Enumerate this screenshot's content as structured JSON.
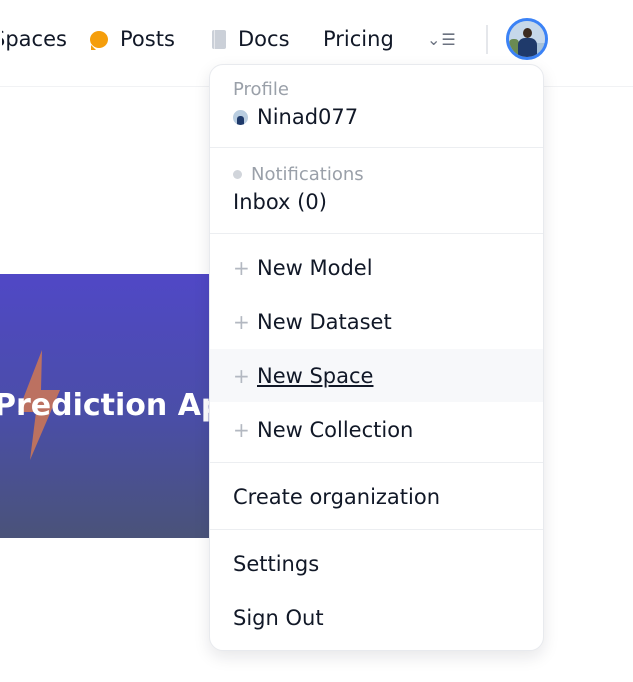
{
  "nav": {
    "spaces_label": "Spaces",
    "posts_label": "Posts",
    "docs_label": "Docs",
    "pricing_label": "Pricing",
    "more_icon": "chevron-menu-icon"
  },
  "banner": {
    "title": "Prediction App"
  },
  "menu": {
    "profile": {
      "section_label": "Profile",
      "username": "Ninad077"
    },
    "notifications": {
      "section_label": "Notifications",
      "inbox_label": "Inbox (0)"
    },
    "create_items": [
      {
        "label": "New Model"
      },
      {
        "label": "New Dataset"
      },
      {
        "label": "New Space"
      },
      {
        "label": "New Collection"
      }
    ],
    "create_org_label": "Create organization",
    "settings_label": "Settings",
    "signout_label": "Sign Out"
  },
  "colors": {
    "accent": "#3b82f6",
    "posts_icon": "#f59e0b",
    "banner_top": "#5048c6",
    "banner_bottom": "#4a5379"
  }
}
